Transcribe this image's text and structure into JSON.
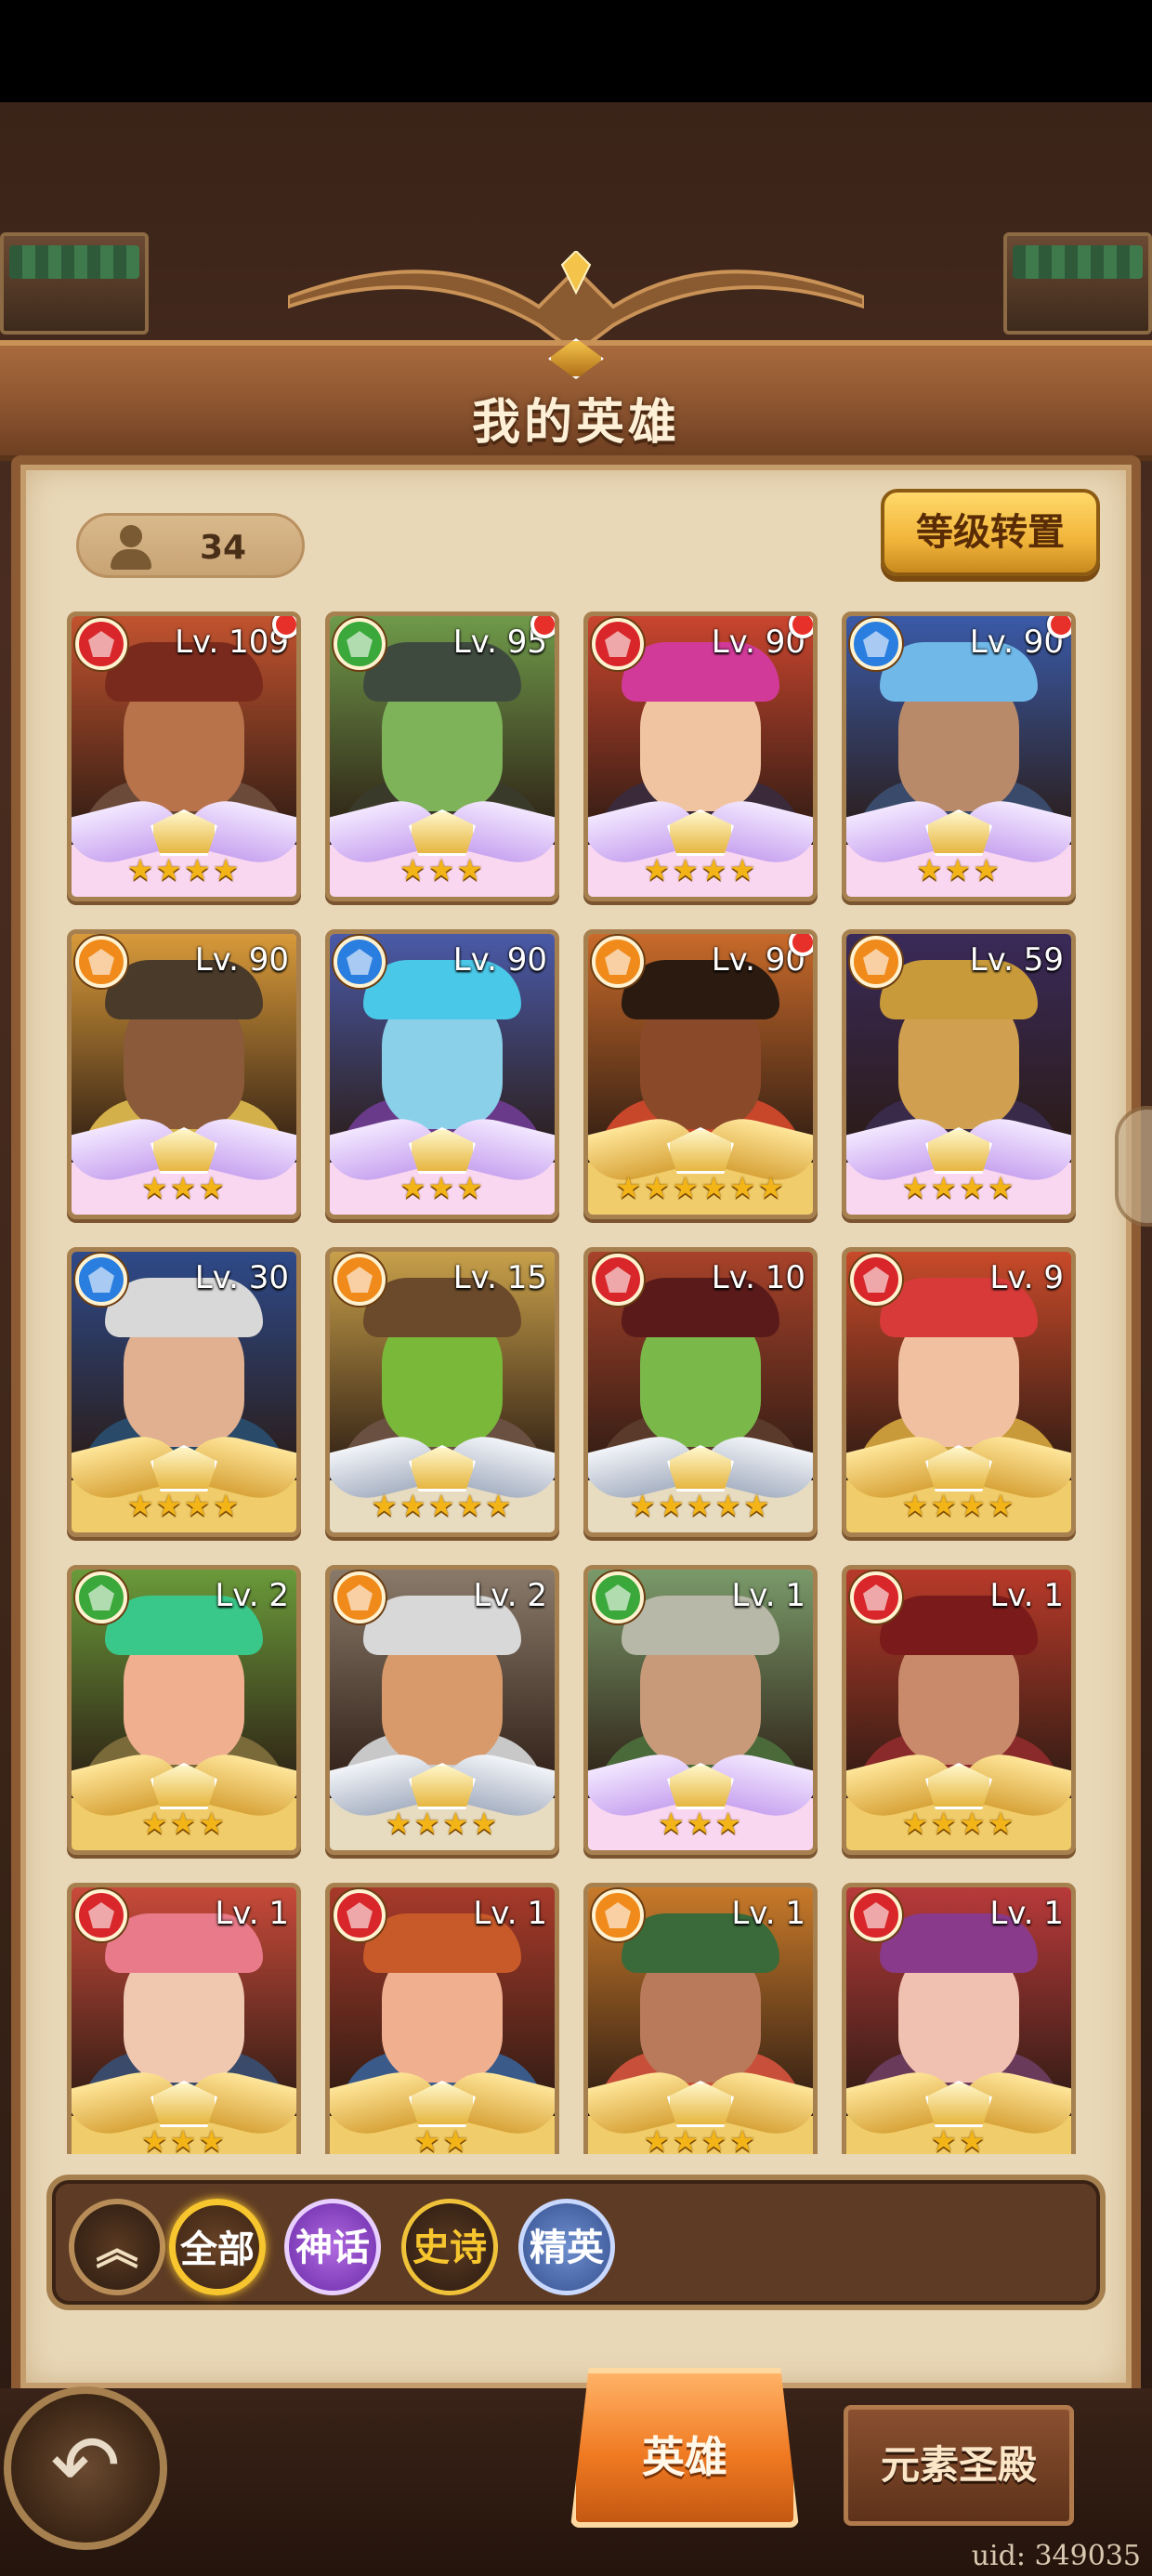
{
  "header": {
    "title": "我的英雄"
  },
  "hero_count": "34",
  "level_transfer_label": "等级转置",
  "heroes": [
    {
      "level": "Lv. 109",
      "element": "fire",
      "stars": "★★★★",
      "frame": "pink",
      "notify": true
    },
    {
      "level": "Lv. 95",
      "element": "nature",
      "stars": "★★★",
      "frame": "pink",
      "notify": true
    },
    {
      "level": "Lv. 90",
      "element": "fire",
      "stars": "★★★★",
      "frame": "pink",
      "notify": true
    },
    {
      "level": "Lv. 90",
      "element": "water",
      "stars": "★★★",
      "frame": "pink",
      "notify": true
    },
    {
      "level": "Lv. 90",
      "element": "light",
      "stars": "★★★",
      "frame": "pink",
      "notify": false
    },
    {
      "level": "Lv. 90",
      "element": "water",
      "stars": "★★★",
      "frame": "pink",
      "notify": false
    },
    {
      "level": "Lv. 90",
      "element": "light",
      "stars": "★★★★★★",
      "frame": "gold",
      "notify": true
    },
    {
      "level": "Lv. 59",
      "element": "light",
      "stars": "★★★★",
      "frame": "pink",
      "notify": false
    },
    {
      "level": "Lv. 30",
      "element": "water",
      "stars": "★★★★",
      "frame": "gold",
      "notify": false
    },
    {
      "level": "Lv. 15",
      "element": "light",
      "stars": "★★★★★",
      "frame": "silver",
      "notify": false
    },
    {
      "level": "Lv. 10",
      "element": "fire",
      "stars": "★★★★★",
      "frame": "silver",
      "notify": false
    },
    {
      "level": "Lv. 9",
      "element": "fire",
      "stars": "★★★★",
      "frame": "gold",
      "notify": false
    },
    {
      "level": "Lv. 2",
      "element": "nature",
      "stars": "★★★",
      "frame": "gold",
      "notify": false
    },
    {
      "level": "Lv. 2",
      "element": "light",
      "stars": "★★★★",
      "frame": "silver",
      "notify": false
    },
    {
      "level": "Lv. 1",
      "element": "nature",
      "stars": "★★★",
      "frame": "pink",
      "notify": false
    },
    {
      "level": "Lv. 1",
      "element": "fire",
      "stars": "★★★★",
      "frame": "gold",
      "notify": false
    },
    {
      "level": "Lv. 1",
      "element": "fire",
      "stars": "★★★",
      "frame": "gold",
      "notify": false
    },
    {
      "level": "Lv. 1",
      "element": "fire",
      "stars": "★★",
      "frame": "gold",
      "notify": false
    },
    {
      "level": "Lv. 1",
      "element": "light",
      "stars": "★★★★",
      "frame": "gold",
      "notify": false
    },
    {
      "level": "Lv. 1",
      "element": "fire",
      "stars": "★★",
      "frame": "gold",
      "notify": false
    }
  ],
  "element_colors": {
    "fire": "#d8262a",
    "nature": "#3aa83a",
    "water": "#2a7ee0",
    "light": "#f08a1a"
  },
  "portrait_palettes": [
    {
      "bg": "#c2532f",
      "hair": "#7a2a1c",
      "face": "#b8734a",
      "body": "#6b4a3a"
    },
    {
      "bg": "#6f9a4a",
      "hair": "#3f4a3f",
      "face": "#7fb35a",
      "body": "#3a3a2a"
    },
    {
      "bg": "#c9452e",
      "hair": "#d23a9a",
      "face": "#f0c4a0",
      "body": "#3a2a3a"
    },
    {
      "bg": "#3a5aa8",
      "hair": "#6fb8e8",
      "face": "#b88a6a",
      "body": "#3a4a6a"
    },
    {
      "bg": "#d89a3a",
      "hair": "#4a3a2a",
      "face": "#8a5a3a",
      "body": "#d4b04a"
    },
    {
      "bg": "#4a5aa8",
      "hair": "#4ac8e8",
      "face": "#8ad0e8",
      "body": "#6a3a8a"
    },
    {
      "bg": "#c86a2a",
      "hair": "#2a1a10",
      "face": "#8a4a2a",
      "body": "#c8462a"
    },
    {
      "bg": "#3a2a5a",
      "hair": "#c89a3a",
      "face": "#d0a050",
      "body": "#3a2a4a"
    },
    {
      "bg": "#2e4a8a",
      "hair": "#d8d8d8",
      "face": "#e0b090",
      "body": "#2a4a6a"
    },
    {
      "bg": "#c8a04a",
      "hair": "#6a4a2a",
      "face": "#7ab83a",
      "body": "#6a5040"
    },
    {
      "bg": "#a8422a",
      "hair": "#5a1a1a",
      "face": "#7ab84a",
      "body": "#5a3a2a"
    },
    {
      "bg": "#c84a2a",
      "hair": "#d83a3a",
      "face": "#f0c0a0",
      "body": "#c89a3a"
    },
    {
      "bg": "#6a9a3a",
      "hair": "#3ac88a",
      "face": "#f0b090",
      "body": "#7a6a3a"
    },
    {
      "bg": "#8a7a6a",
      "hair": "#d8d8d8",
      "face": "#d89a6a",
      "body": "#c8c8c8"
    },
    {
      "bg": "#7a9a6a",
      "hair": "#b8b8a8",
      "face": "#c89a7a",
      "body": "#4a6a3a"
    },
    {
      "bg": "#b83a2a",
      "hair": "#7a1a1a",
      "face": "#c88a6a",
      "body": "#8a2a2a"
    },
    {
      "bg": "#c84a3a",
      "hair": "#e87a8a",
      "face": "#f0c8b0",
      "body": "#3a4a6a"
    },
    {
      "bg": "#a83a2a",
      "hair": "#c85a2a",
      "face": "#f0b090",
      "body": "#3a5a8a"
    },
    {
      "bg": "#c87a2a",
      "hair": "#3a6a3a",
      "face": "#b87a5a",
      "body": "#c8503a"
    },
    {
      "bg": "#b83a3a",
      "hair": "#8a3a8a",
      "face": "#f0c0b0",
      "body": "#6a3a5a"
    }
  ],
  "filters": {
    "collapse_glyph": "︽",
    "all": "全部",
    "myth": "神话",
    "epic": "史诗",
    "elite": "精英"
  },
  "tabs": {
    "heroes": "英雄",
    "element_shrine": "元素圣殿"
  },
  "back_glyph": "↶",
  "uid": "uid: 349035"
}
